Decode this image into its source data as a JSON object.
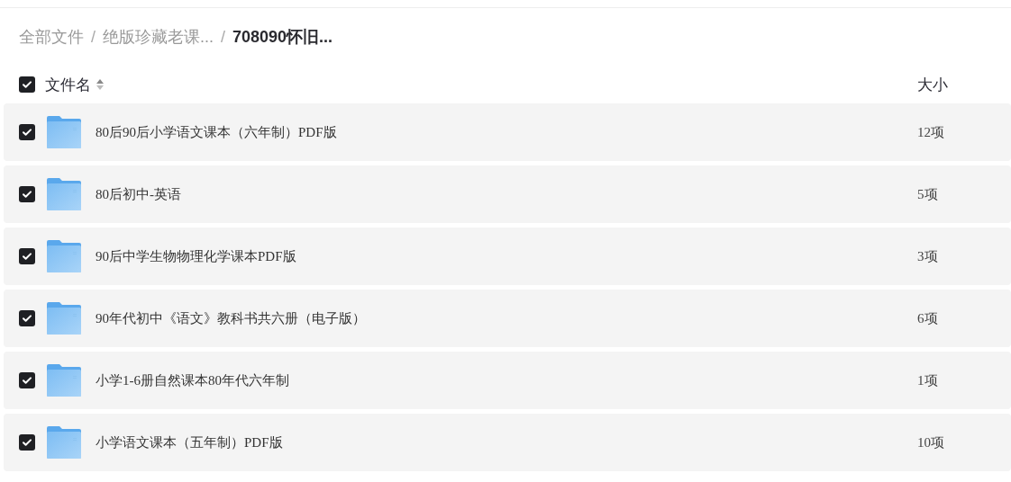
{
  "breadcrumb": [
    {
      "label": "全部文件",
      "current": false
    },
    {
      "separator": "/",
      "label": "绝版珍藏老课...",
      "current": false
    },
    {
      "separator": "/",
      "label": "708090怀旧...",
      "current": true
    }
  ],
  "header": {
    "checked": true,
    "name_column": "文件名",
    "size_column": "大小"
  },
  "rows": [
    {
      "name": "80后90后小学语文课本（六年制）PDF版",
      "size": "12项",
      "checked": true
    },
    {
      "name": "80后初中-英语",
      "size": "5项",
      "checked": true
    },
    {
      "name": "90后中学生物物理化学课本PDF版",
      "size": "3项",
      "checked": true
    },
    {
      "name": "90年代初中《语文》教科书共六册（电子版）",
      "size": "6项",
      "checked": true
    },
    {
      "name": "小学1-6册自然课本80年代六年制",
      "size": "1项",
      "checked": true
    },
    {
      "name": "小学语文课本（五年制）PDF版",
      "size": "10项",
      "checked": true
    }
  ]
}
